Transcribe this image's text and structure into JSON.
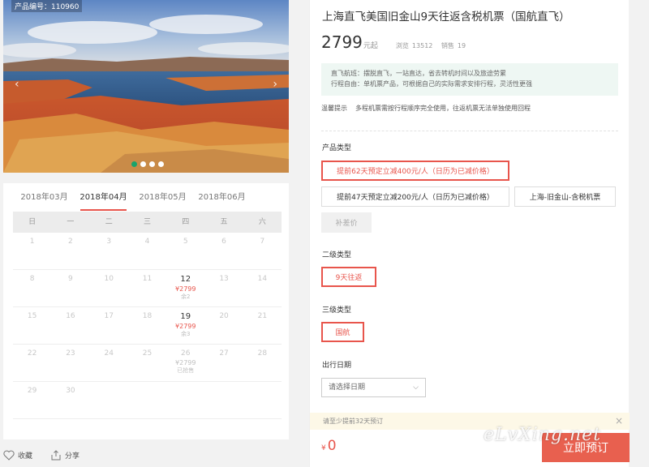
{
  "hero": {
    "product_code": "产品编号：110960",
    "carousel_total": 4,
    "carousel_active": 1
  },
  "calendar": {
    "months": [
      "2018年03月",
      "2018年04月",
      "2018年05月",
      "2018年06月"
    ],
    "active_month": "2018年04月",
    "weekdays": [
      "日",
      "一",
      "二",
      "三",
      "四",
      "五",
      "六"
    ],
    "weeks": [
      [
        {
          "d": "1"
        },
        {
          "d": "2"
        },
        {
          "d": "3"
        },
        {
          "d": "4"
        },
        {
          "d": "5"
        },
        {
          "d": "6"
        },
        {
          "d": "7"
        }
      ],
      [
        {
          "d": "8"
        },
        {
          "d": "9"
        },
        {
          "d": "10"
        },
        {
          "d": "11"
        },
        {
          "d": "12",
          "price": "¥2799",
          "rest": "余2",
          "available": true
        },
        {
          "d": "13"
        },
        {
          "d": "14"
        }
      ],
      [
        {
          "d": "15"
        },
        {
          "d": "16"
        },
        {
          "d": "17"
        },
        {
          "d": "18"
        },
        {
          "d": "19",
          "price": "¥2799",
          "rest": "余3",
          "available": true
        },
        {
          "d": "20"
        },
        {
          "d": "21"
        }
      ],
      [
        {
          "d": "22"
        },
        {
          "d": "23"
        },
        {
          "d": "24"
        },
        {
          "d": "25"
        },
        {
          "d": "26",
          "price": "¥2799",
          "rest": "已抢售"
        },
        {
          "d": "27"
        },
        {
          "d": "28"
        }
      ],
      [
        {
          "d": "29"
        },
        {
          "d": "30"
        },
        {
          "d": ""
        },
        {
          "d": ""
        },
        {
          "d": ""
        },
        {
          "d": ""
        },
        {
          "d": ""
        }
      ]
    ]
  },
  "actions": {
    "favorite": "收藏",
    "share": "分享"
  },
  "product": {
    "title": "上海直飞美国旧金山9天往返含税机票（国航直飞）",
    "price": "2799",
    "price_unit": "元起",
    "views_label": "浏览",
    "views": "13512",
    "sales_label": "销售",
    "sales": "19",
    "info_lines": [
      "直飞航班：摆脱直飞，一站直达，省去转机时间以及旅途劳累",
      "行程自由：单机票产品，可根据自己的实际需求安排行程，灵活性更强"
    ],
    "tip_label": "温馨提示",
    "tip_text": "多程机票需按行程顺序完全使用，往返机票无法单独使用回程"
  },
  "options": {
    "product_type_label": "产品类型",
    "product_types": [
      "提前62天预定立减400元/人（日历为已减价格）",
      "提前47天预定立减200元/人（日历为已减价格）",
      "上海-旧金山-含税机票",
      "补差价"
    ],
    "level2_label": "二级类型",
    "level2": "9天往返",
    "level3_label": "三级类型",
    "level3": "国航",
    "date_label": "出行日期",
    "date_placeholder": "请选择日期"
  },
  "booking": {
    "notice": "请至少提前32天预订",
    "currency": "¥",
    "total": "0",
    "book_label": "立即预订"
  },
  "watermark": "eLvXing.net",
  "colors": {
    "accent": "#e8554c",
    "info_bg": "#eef7f3",
    "notice_bg": "#fdf8e7"
  }
}
